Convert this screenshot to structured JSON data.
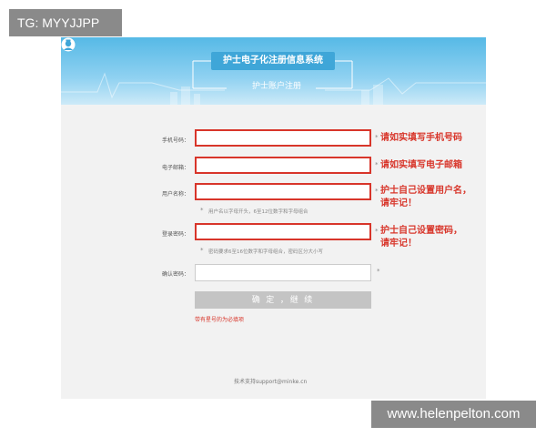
{
  "watermark_top": "TG: MYYJJPP",
  "watermark_bottom": "www.helenpelton.com",
  "banner": {
    "title": "护士电子化注册信息系统",
    "subtitle": "护士账户注册",
    "avatar_icon": "nurse-avatar-icon"
  },
  "form": {
    "rows": [
      {
        "label": "手机号码：",
        "value": ""
      },
      {
        "label": "电子邮箱：",
        "value": ""
      },
      {
        "label": "用户名称：",
        "value": ""
      },
      {
        "label": "登录密码：",
        "value": ""
      },
      {
        "label": "确认密码：",
        "value": ""
      }
    ],
    "required_mark": "*",
    "username_hint": "用户名以字母开头，6至12位数字和字母组合",
    "password_hint": "密码要求6至16位数字和字母组合，密码区分大小写",
    "submit_label": "确 定 ，继 续",
    "problem_link": "带有星号的为必填项"
  },
  "annotations": {
    "phone": "请如实填写手机号码",
    "email": "请如实填写电子邮箱",
    "username_line1": "护士自己设置用户名，",
    "username_line2": "请牢记！",
    "password_line1": "护士自己设置密码，",
    "password_line2": "请牢记！",
    "color": "#d8352a"
  },
  "footer": {
    "support": "技术支持support@minke.cn"
  },
  "colors": {
    "banner": "#56b9e6",
    "highlight": "#d8352a",
    "background": "#f2f2f2"
  }
}
